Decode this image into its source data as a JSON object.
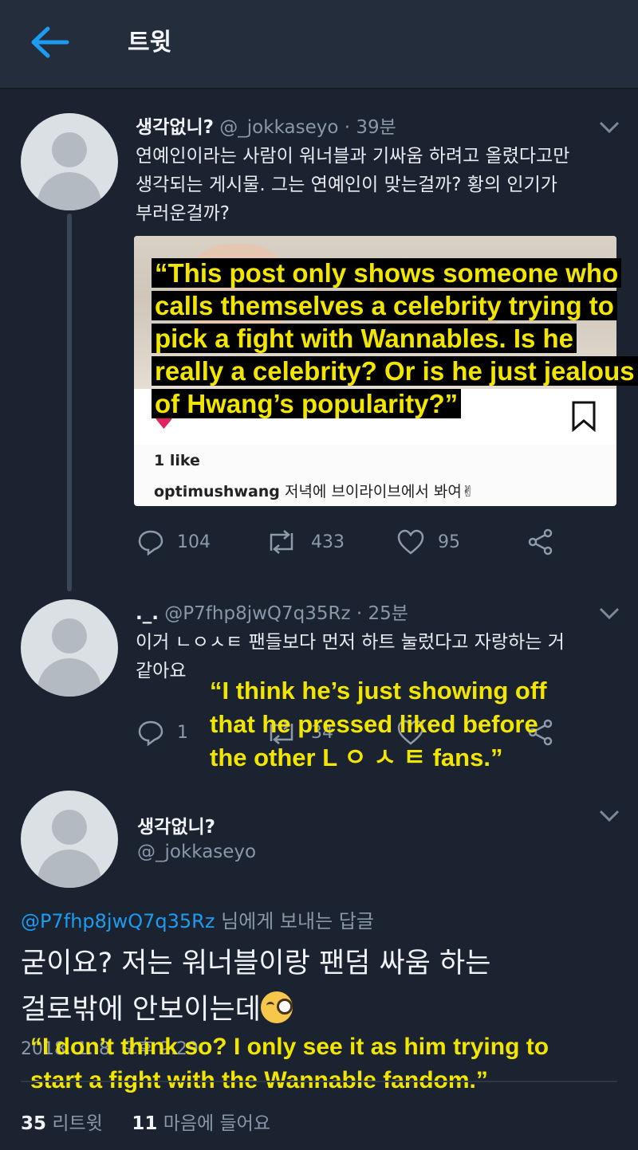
{
  "header": {
    "title": "트윗"
  },
  "tweet1": {
    "name": "생각없니?",
    "handle": "@_jokkaseyo · 39분",
    "text_lines": [
      "연예인이라는 사람이 워너블과 기싸움 하려고 올렸다고만",
      "생각되는 게시물. 그는 연예인이 맞는걸까? 황의 인기가",
      "부러운걸까?"
    ],
    "embed": {
      "likes": "1 like",
      "caption_user": "optimushwang",
      "caption_text": "저녁에 브이라이브에서 봐여✌"
    },
    "replies": "104",
    "retweets": "433",
    "likes": "95"
  },
  "tweet2": {
    "name": "._.",
    "handle": "@P7fhp8jwQ7q35Rz · 25분",
    "text_lines": [
      "이거 ㄴㅇㅅㅌ 팬들보다 먼저 하트 눌렀다고 자랑하는 거",
      "같아요"
    ],
    "replies": "1",
    "retweets": "34"
  },
  "tweet3": {
    "name": "생각없니?",
    "handle": "@_jokkaseyo",
    "reply_to": "@P7fhp8jwQ7q35Rz",
    "reply_to_suffix": "님에게 보내는 답글",
    "text_lines": [
      "굳이요? 저는 워너블이랑 팬덤 싸움 하는",
      "걸로밖에 안보이는데"
    ],
    "timestamp": "2018. 1. 8. 오후 9:29",
    "retweet_count": "35",
    "retweet_label": "리트윗",
    "like_count": "11",
    "like_label": "마음에 들어요"
  },
  "overlays": {
    "translation1": [
      "“This post only shows someone who",
      "calls themselves a  celebrity trying to",
      "pick a fight with Wannables. Is he",
      "really a celebrity? Or is he just jealous",
      "of Hwang’s popularity?”"
    ],
    "translation2": [
      "“I think he’s just showing off",
      "that he pressed liked before",
      "the other L ㅇ ㅅ ㅌ fans.”"
    ],
    "translation3": [
      "“I don’t think so? I only see it as him trying to",
      "start a fight with the Wannable fandom.”"
    ]
  },
  "colors": {
    "background": "#1b2331",
    "header": "#232d3b",
    "accent": "#1d9bf0",
    "overlay_text": "#f2e600",
    "like_red": "#e0245e"
  }
}
